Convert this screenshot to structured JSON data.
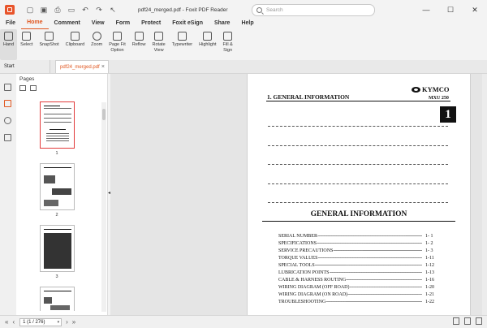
{
  "window": {
    "doc_title": "pdf24_merged.pdf - Foxit PDF Reader",
    "search_placeholder": "Search",
    "min": "—",
    "max": "☐",
    "close": "✕"
  },
  "quick_access": [
    "▢",
    "▣",
    "⎙",
    "▭",
    "↶",
    "↷",
    "↖"
  ],
  "menu": [
    "File",
    "Home",
    "Comment",
    "View",
    "Form",
    "Protect",
    "Foxit eSign",
    "Share",
    "Help"
  ],
  "ribbon": [
    "Hand",
    "Select",
    "SnapShot",
    "Clipboard",
    "Zoom",
    "Page Fit\nOption",
    "Reflow",
    "Rotate\nView",
    "Typewriter",
    "Highlight",
    "Fill &\nSign"
  ],
  "tabs": {
    "start": "Start",
    "doc": "pdf24_merged.pdf",
    "close": "×"
  },
  "panel": {
    "title": "Pages",
    "thumb_numbers": [
      "1",
      "2",
      "3"
    ]
  },
  "collapse_arrow": "◂",
  "page": {
    "header_title": "1. GENERAL INFORMATION",
    "brand": "KYMCO",
    "model": "MXU 250",
    "chapter": "1",
    "section_title": "GENERAL INFORMATION",
    "toc": [
      {
        "t": "SERIAL NUMBER",
        "p": "1- 1"
      },
      {
        "t": "SPECIFICATIONS",
        "p": "1- 2"
      },
      {
        "t": "SERVICE PRECAUTIONS",
        "p": "1- 3"
      },
      {
        "t": "TORQUE VALUES",
        "p": "1-11"
      },
      {
        "t": "SPECIAL TOOLS",
        "p": "1-12"
      },
      {
        "t": "LUBRICATION POINTS",
        "p": "1-13"
      },
      {
        "t": "CABLE & HARNESS ROUTING",
        "p": "1-16"
      },
      {
        "t": "WIRING DIAGRAM (OFF ROAD)",
        "p": "1-20"
      },
      {
        "t": "WIRING DIAGRAM (ON ROAD)",
        "p": "1-21"
      },
      {
        "t": "TROUBLESHOOTING",
        "p": "1-22"
      }
    ]
  },
  "status": {
    "first": "«",
    "prev": "‹",
    "page_value": "1 (1 / 276)",
    "next": "›",
    "last": "»"
  }
}
